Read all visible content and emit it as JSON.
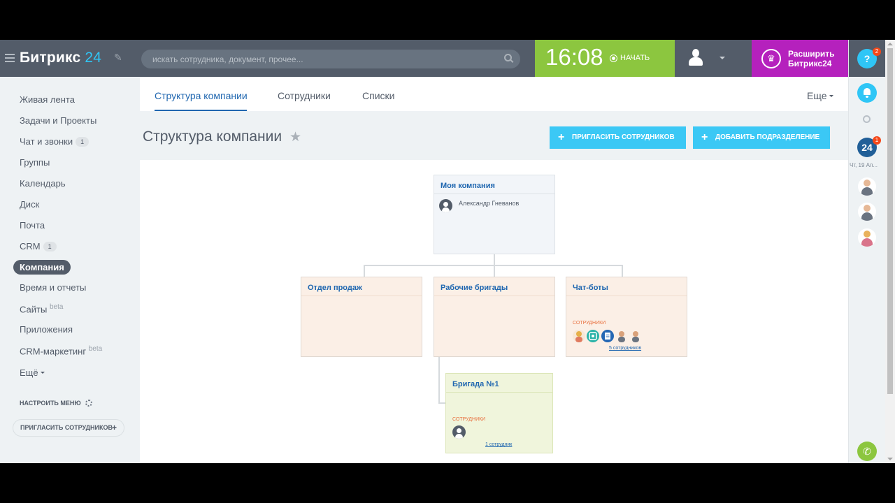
{
  "header": {
    "logo_text": "Битрикс",
    "logo_num": "24",
    "search_placeholder": "искать сотрудника, документ, прочее...",
    "clock": "16:08",
    "start_label": "НАЧАТЬ",
    "upgrade_line1": "Расширить",
    "upgrade_line2": "Битрикс24",
    "help_label": "?",
    "help_badge": "2"
  },
  "rail": {
    "b24_label": "24",
    "b24_badge": "1",
    "date": "Чт, 19 Ап..."
  },
  "sidebar": {
    "items": [
      {
        "label": "Живая лента"
      },
      {
        "label": "Задачи и Проекты"
      },
      {
        "label": "Чат и звонки",
        "count": "1"
      },
      {
        "label": "Группы"
      },
      {
        "label": "Календарь"
      },
      {
        "label": "Диск"
      },
      {
        "label": "Почта"
      },
      {
        "label": "CRM",
        "count": "1"
      },
      {
        "label": "Компания"
      },
      {
        "label": "Время и отчеты"
      },
      {
        "label": "Сайты",
        "sup": "beta"
      },
      {
        "label": "Приложения"
      },
      {
        "label": "CRM-маркетинг",
        "sup": "beta"
      },
      {
        "label": "Ещё"
      }
    ],
    "settings_label": "НАСТРОИТЬ МЕНЮ",
    "invite_label": "ПРИГЛАСИТЬ СОТРУДНИКОВ",
    "invite_plus": "+"
  },
  "tabs": {
    "items": [
      {
        "label": "Структура компании"
      },
      {
        "label": "Сотрудники"
      },
      {
        "label": "Списки"
      }
    ],
    "more_label": "Еще"
  },
  "page": {
    "title": "Структура компании",
    "invite_button": "ПРИГЛАСИТЬ СОТРУДНИКОВ",
    "add_dept_button": "ДОБАВИТЬ ПОДРАЗДЕЛЕНИЕ"
  },
  "org": {
    "root": {
      "title": "Моя компания",
      "head": "Александр Гневанов"
    },
    "sales": {
      "title": "Отдел продаж"
    },
    "brigades": {
      "title": "Рабочие бригады"
    },
    "chatbots": {
      "title": "Чат-боты",
      "emp_label": "СОТРУДНИКИ",
      "count_label": "5 сотрудников"
    },
    "brigade1": {
      "title": "Бригада №1",
      "emp_label": "СОТРУДНИКИ",
      "count_label": "1 сотрудник"
    }
  },
  "colors": {
    "header": "#535c69",
    "accent": "#2fc6f6",
    "timer": "#8cc63f",
    "upgrade": "#b521bd",
    "root_card": "#f2f5f9",
    "dept_card": "#fbefe6",
    "sub_card": "#f0f5dc"
  }
}
